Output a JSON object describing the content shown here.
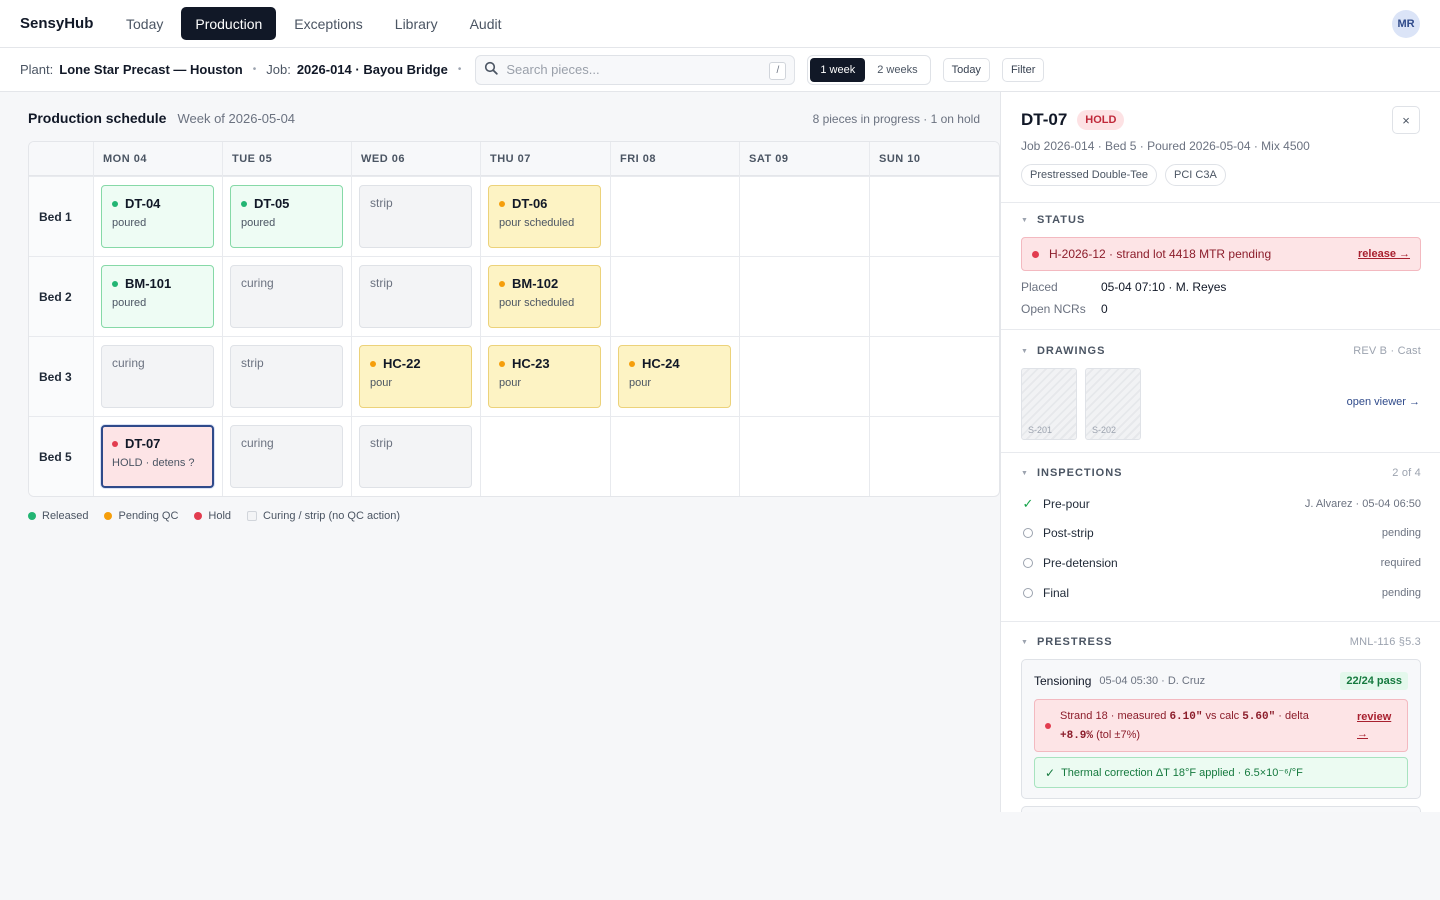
{
  "app": {
    "brand": "SensyHub",
    "nav": [
      "Today",
      "Production",
      "Exceptions",
      "Library",
      "Audit"
    ],
    "avatar_initials": "MR"
  },
  "toolbar": {
    "plant_label": "Plant:",
    "plant_value": "Lone Star Precast — Houston",
    "job_label": "Job:",
    "job_value": "2026-014 · Bayou Bridge",
    "search_placeholder": "Search pieces...",
    "search_shortcut": "/",
    "range_options": [
      "1 week",
      "2 weeks"
    ],
    "range_selected": "1 week",
    "today_button": "Today",
    "filter_button": "Filter"
  },
  "schedule": {
    "title": "Production schedule",
    "week": "Week of 2026-05-04",
    "summary": "8 pieces in progress · 1 on hold",
    "days": [
      "MON 04",
      "TUE 05",
      "WED 06",
      "THU 07",
      "FRI 08",
      "SAT 09",
      "SUN 10"
    ],
    "beds": [
      {
        "label": "Bed 1",
        "cells": [
          {
            "day": 0,
            "kind": "released",
            "piece": "DT-04",
            "status": "poured"
          },
          {
            "day": 1,
            "kind": "released",
            "piece": "DT-05",
            "status": "poured"
          },
          {
            "day": 2,
            "kind": "neutral",
            "status": "strip"
          },
          {
            "day": 3,
            "kind": "pending",
            "piece": "DT-06",
            "status": "pour scheduled"
          }
        ]
      },
      {
        "label": "Bed 2",
        "cells": [
          {
            "day": 0,
            "kind": "released",
            "piece": "BM-101",
            "status": "poured"
          },
          {
            "day": 1,
            "kind": "neutral",
            "status": "curing"
          },
          {
            "day": 2,
            "kind": "neutral",
            "status": "strip"
          },
          {
            "day": 3,
            "kind": "pending",
            "piece": "BM-102",
            "status": "pour scheduled"
          }
        ]
      },
      {
        "label": "Bed 3",
        "cells": [
          {
            "day": 0,
            "kind": "neutral",
            "status": "curing"
          },
          {
            "day": 1,
            "kind": "neutral",
            "status": "strip"
          },
          {
            "day": 2,
            "kind": "pending",
            "piece": "HC-22",
            "status": "pour"
          },
          {
            "day": 3,
            "kind": "pending",
            "piece": "HC-23",
            "status": "pour"
          },
          {
            "day": 4,
            "kind": "pending",
            "piece": "HC-24",
            "status": "pour"
          }
        ]
      },
      {
        "label": "Bed 5",
        "cells": [
          {
            "day": 0,
            "kind": "hold",
            "piece": "DT-07",
            "status": "HOLD · detens ?"
          },
          {
            "day": 1,
            "kind": "neutral",
            "status": "curing"
          },
          {
            "day": 2,
            "kind": "neutral",
            "status": "strip"
          }
        ]
      }
    ],
    "legend": [
      {
        "label": "Released",
        "color": "#22b573",
        "kind": "dot"
      },
      {
        "label": "Pending QC",
        "color": "#f59e0b",
        "kind": "dot"
      },
      {
        "label": "Hold",
        "color": "#e23c4f",
        "kind": "dot"
      },
      {
        "label": "Curing / strip (no QC action)",
        "kind": "square"
      }
    ]
  },
  "colors": {
    "released": "#22b573",
    "pending": "#f59e0b",
    "hold": "#e23c4f",
    "accent": "#2f4a8a"
  },
  "panel": {
    "piece": "DT-07",
    "badge": "HOLD",
    "meta": "Job 2026-014 · Bed 5 · Poured 2026-05-04 · Mix 4500",
    "tags": [
      "Prestressed Double-Tee",
      "PCI C3A"
    ],
    "close": "×",
    "status": {
      "heading": "STATUS",
      "alert": "H-2026-12 · strand lot 4418 MTR pending",
      "alert_link": "release →",
      "placed_label": "Placed",
      "placed_value": "05-04 07:10 · M. Reyes",
      "ncr_label": "Open NCRs",
      "ncr_value": "0"
    },
    "drawings": {
      "heading": "DRAWINGS",
      "rev": "REV B · Cast",
      "sheets": [
        "S-201",
        "S-202"
      ],
      "viewer_link": "open viewer →"
    },
    "inspections": {
      "heading": "INSPECTIONS",
      "count": "2 of 4",
      "items": [
        {
          "name": "Pre-pour",
          "done": true,
          "right": "J. Alvarez · 05-04 06:50"
        },
        {
          "name": "Post-strip",
          "done": false,
          "right": "pending"
        },
        {
          "name": "Pre-detension",
          "done": false,
          "right": "required"
        },
        {
          "name": "Final",
          "done": false,
          "right": "pending"
        }
      ]
    },
    "prestress": {
      "heading": "PRESTRESS",
      "ref": "MNL-116 §5.3",
      "tension_label": "Tensioning",
      "tension_meta": "05-04 05:30 · D. Cruz",
      "pass": "22/24 pass",
      "err_prefix": "Strand 18 · measured ",
      "err_measured": "6.10\"",
      "err_mid": " vs calc ",
      "err_calc": "5.60\"",
      "err_delta_prefix": " · delta ",
      "err_delta": "+8.9%",
      "err_tol": " (tol ±7%)",
      "err_link": "review →",
      "thermal": "Thermal correction ΔT 18°F applied · 6.5×10⁻⁶/°F"
    }
  }
}
